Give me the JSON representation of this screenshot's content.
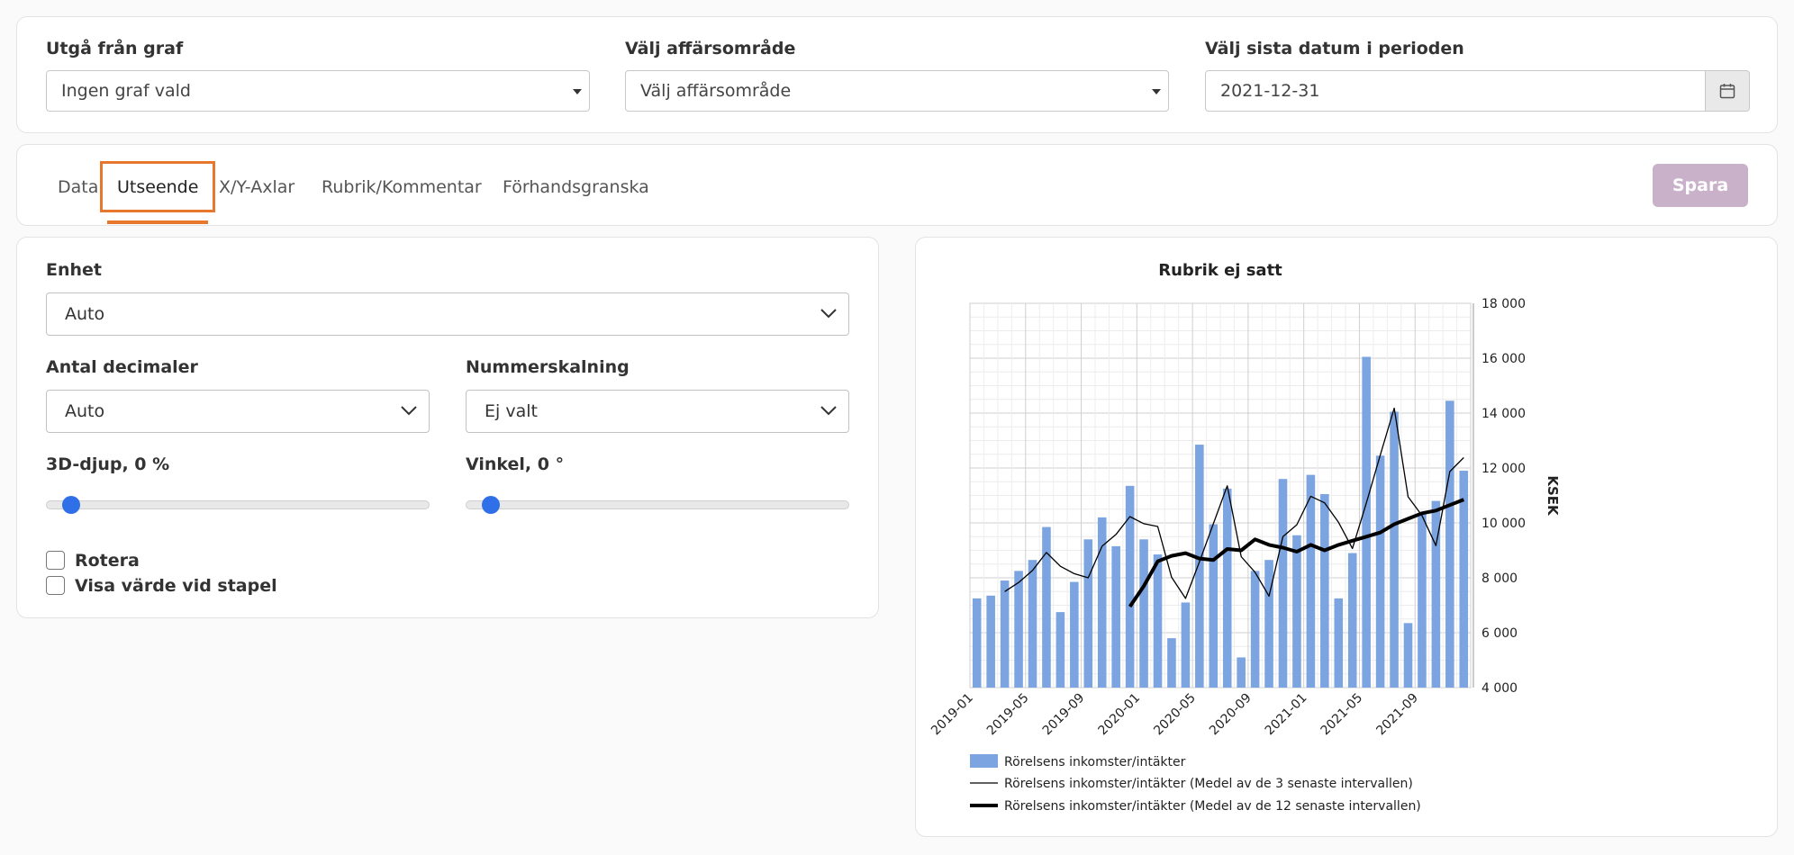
{
  "filters": {
    "graph": {
      "label": "Utgå från graf",
      "value": "Ingen graf vald"
    },
    "area": {
      "label": "Välj affärsområde",
      "value": "Välj affärsområde"
    },
    "date": {
      "label": "Välj sista datum i perioden",
      "value": "2021-12-31"
    }
  },
  "tabs": {
    "items": [
      {
        "label": "Data"
      },
      {
        "label": "Utseende"
      },
      {
        "label": "X/Y-Axlar"
      },
      {
        "label": "Rubrik/Kommentar"
      },
      {
        "label": "Förhandsgranska"
      }
    ],
    "active_index": 1,
    "save_label": "Spara"
  },
  "settings": {
    "enhet": {
      "label": "Enhet",
      "value": "Auto"
    },
    "decimaler": {
      "label": "Antal decimaler",
      "value": "Auto"
    },
    "skalning": {
      "label": "Nummerskalning",
      "value": "Ej valt"
    },
    "djup": {
      "label": "3D-djup, 0 %",
      "value": 0
    },
    "vinkel": {
      "label": "Vinkel, 0 °",
      "value": 0
    },
    "rotera": {
      "label": "Rotera",
      "checked": false
    },
    "visa_varde": {
      "label": "Visa värde vid stapel",
      "checked": false
    }
  },
  "colors": {
    "accent": "#e8772e",
    "slider": "#2f6fe8",
    "bar": "#7ba4e0",
    "save": "#c9b1c9"
  },
  "chart_data": {
    "type": "bar",
    "title": "Rubrik ej satt",
    "ylabel": "KSEK",
    "ylim": [
      4000,
      18000
    ],
    "yticks": [
      "4 000",
      "6 000",
      "8 000",
      "10 000",
      "12 000",
      "14 000",
      "16 000",
      "18 000"
    ],
    "xtick_labels": [
      "2019-01",
      "2019-05",
      "2019-09",
      "2020-01",
      "2020-05",
      "2020-09",
      "2021-01",
      "2021-05",
      "2021-09"
    ],
    "categories": [
      "2019-01",
      "2019-02",
      "2019-03",
      "2019-04",
      "2019-05",
      "2019-06",
      "2019-07",
      "2019-08",
      "2019-09",
      "2019-10",
      "2019-11",
      "2019-12",
      "2020-01",
      "2020-02",
      "2020-03",
      "2020-04",
      "2020-05",
      "2020-06",
      "2020-07",
      "2020-08",
      "2020-09",
      "2020-10",
      "2020-11",
      "2020-12",
      "2021-01",
      "2021-02",
      "2021-03",
      "2021-04",
      "2021-05",
      "2021-06",
      "2021-07",
      "2021-08",
      "2021-09",
      "2021-10",
      "2021-11",
      "2021-12"
    ],
    "grid": true,
    "legend_position": "bottom",
    "series": [
      {
        "name": "Rörelsens inkomster/intäkter",
        "kind": "bar",
        "values": [
          7250,
          7350,
          7900,
          8250,
          8650,
          9850,
          6750,
          7850,
          9400,
          10200,
          9150,
          11350,
          9400,
          8850,
          5800,
          7100,
          12850,
          9950,
          11250,
          5100,
          8250,
          8650,
          11600,
          9550,
          11750,
          11050,
          7250,
          8900,
          16050,
          12450,
          14050,
          6350,
          10350,
          10800,
          14450,
          11900
        ]
      },
      {
        "name": "Rörelsens inkomster/intäkter (Medel av de 3 senaste intervallen)",
        "kind": "line-thin",
        "values": [
          null,
          null,
          7500,
          7830,
          8270,
          8920,
          8420,
          8150,
          8000,
          9150,
          9580,
          10230,
          9970,
          9870,
          8020,
          7250,
          8580,
          9970,
          11350,
          8770,
          8200,
          7330,
          9500,
          9930,
          10970,
          10730,
          10020,
          9070,
          10730,
          12470,
          14180,
          10950,
          10270,
          9170,
          11870,
          12380
        ]
      },
      {
        "name": "Rörelsens inkomster/intäkter (Medel av de 12 senaste intervallen)",
        "kind": "line-thick",
        "values": [
          null,
          null,
          null,
          null,
          null,
          null,
          null,
          null,
          null,
          null,
          null,
          6950,
          7700,
          8600,
          8800,
          8900,
          8700,
          8650,
          9050,
          9000,
          9400,
          9200,
          9100,
          8950,
          9200,
          9000,
          9200,
          9350,
          9500,
          9650,
          9950,
          10150,
          10350,
          10450,
          10650,
          10850
        ]
      }
    ]
  }
}
